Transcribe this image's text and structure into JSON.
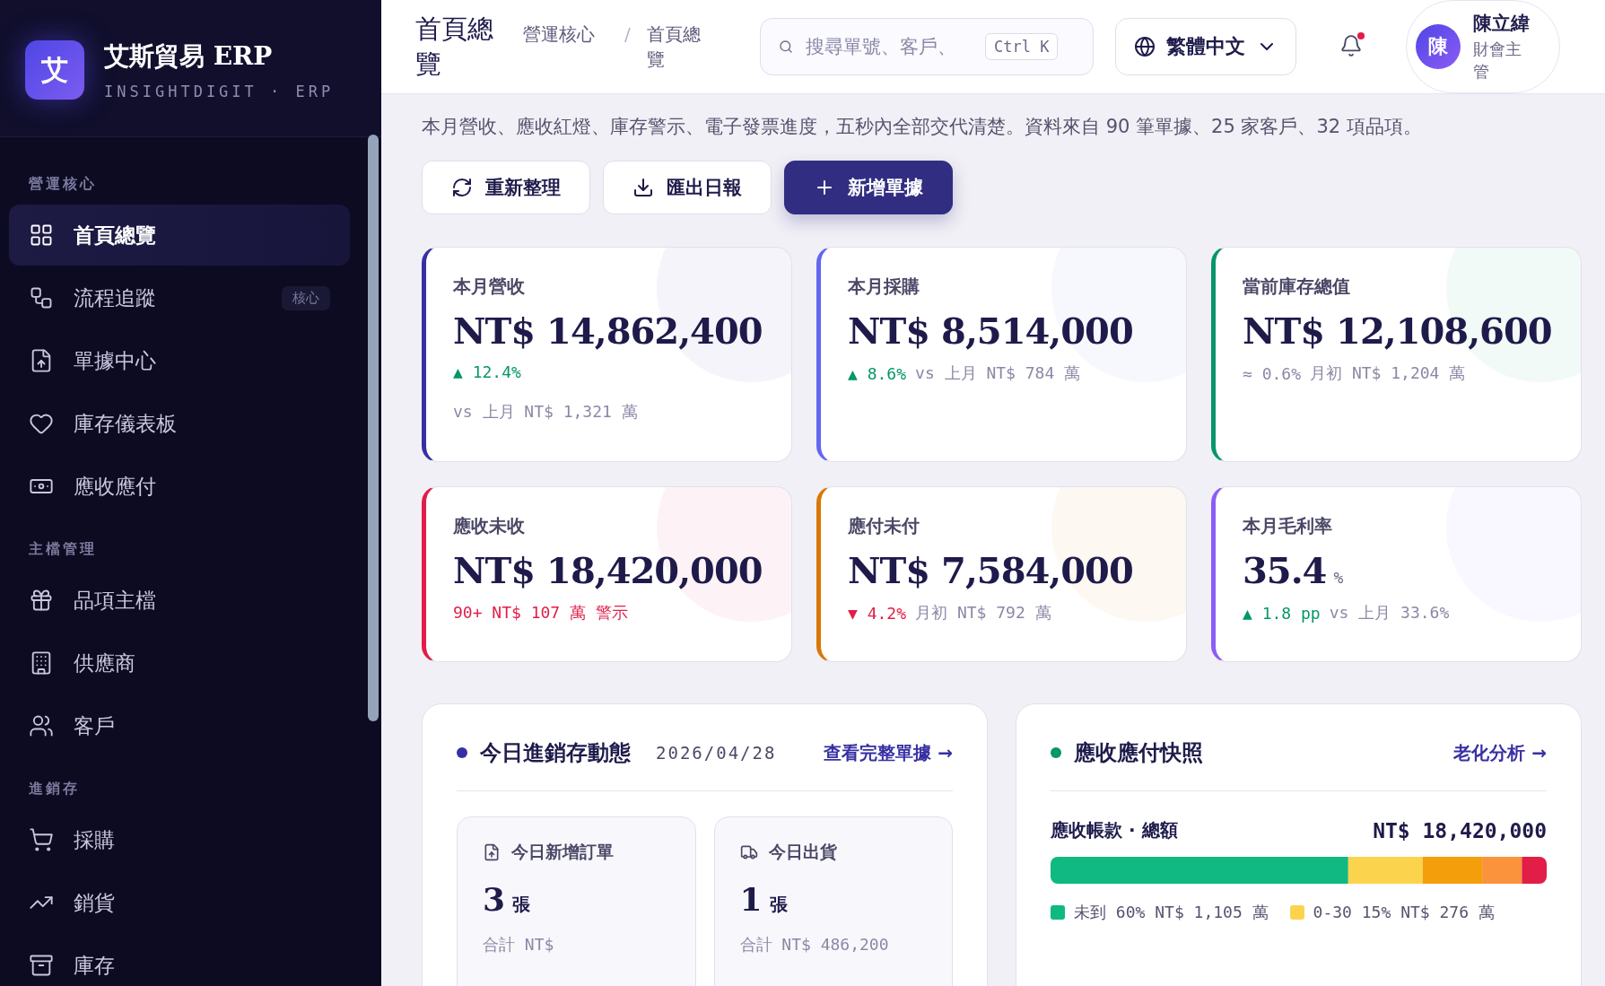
{
  "sidebar": {
    "brand": {
      "logo_letter": "艾",
      "name": "艾斯貿易 ERP",
      "subtitle": "INSIGHTDIGIT · ERP"
    },
    "sections": [
      {
        "title": "營運核心",
        "items": [
          {
            "label": "首頁總覽",
            "selected": true
          },
          {
            "label": "流程追蹤",
            "selected": false,
            "badge": "核心"
          },
          {
            "label": "單據中心",
            "selected": false
          },
          {
            "label": "庫存儀表板",
            "selected": false
          },
          {
            "label": "應收應付",
            "selected": false
          }
        ]
      },
      {
        "title": "主檔管理",
        "items": [
          {
            "label": "品項主檔",
            "selected": false
          },
          {
            "label": "供應商",
            "selected": false
          },
          {
            "label": "客戶",
            "selected": false
          }
        ]
      },
      {
        "title": "進銷存",
        "items": [
          {
            "label": "採購",
            "selected": false
          },
          {
            "label": "銷貨",
            "selected": false
          },
          {
            "label": "庫存",
            "selected": false
          }
        ]
      }
    ]
  },
  "header": {
    "title": "首頁總覽",
    "breadcrumb": [
      "營運核心",
      "首頁總覽"
    ],
    "breadcrumb_separator": "/",
    "search": {
      "placeholder": "搜尋單號、客戶、",
      "shortcut": "Ctrl K"
    },
    "language": "繁體中文",
    "notification_dot": true,
    "user": {
      "avatar_letter": "陳",
      "name": "陳立緯",
      "role": "財會主管"
    }
  },
  "intro": "本月營收、應收紅燈、庫存警示、電子發票進度，五秒內全部交代清楚。資料來自 90 筆單據、25 家客戶、32 項品項。",
  "actions": [
    {
      "label": "重新整理",
      "kind": "refresh"
    },
    {
      "label": "匯出日報",
      "kind": "export"
    },
    {
      "label": "新增單據",
      "kind": "primary"
    }
  ],
  "kpis": [
    {
      "label": "本月營收",
      "value": "NT$ 14,862,400",
      "color": "#3730a3",
      "trend": {
        "marker": "▲",
        "text": "12.4%",
        "color": "#059669"
      },
      "note": "vs 上月 NT$ 1,321 萬",
      "note_below": true,
      "alert": false
    },
    {
      "label": "本月採購",
      "value": "NT$ 8,514,000",
      "color": "#6366f1",
      "trend": {
        "marker": "▲",
        "text": "8.6%",
        "color": "#059669"
      },
      "note": "vs 上月 NT$ 784 萬",
      "note_below": false,
      "alert": false
    },
    {
      "label": "當前庫存總值",
      "value": "NT$ 12,108,600",
      "color": "#059669",
      "trend": {
        "marker": "≈",
        "text": "0.6%",
        "color": "#8a88a6"
      },
      "note": "月初 NT$ 1,204 萬",
      "note_below": false,
      "alert": false
    },
    {
      "label": "應收未收",
      "value": "NT$ 18,420,000",
      "color": "#e11d48",
      "note": "90+ NT$ 107 萬 警示",
      "note_below": false,
      "alert": true
    },
    {
      "label": "應付未付",
      "value": "NT$ 7,584,000",
      "color": "#d97706",
      "trend": {
        "marker": "▼",
        "text": "4.2%",
        "color": "#e11d48"
      },
      "note": "月初 NT$ 792 萬",
      "note_below": false,
      "alert": false
    },
    {
      "label": "本月毛利率",
      "value": "35.4",
      "unit": "%",
      "color": "#8b5cf6",
      "trend": {
        "marker": "▲",
        "text": "1.8 pp",
        "color": "#059669"
      },
      "note": "vs 上月 33.6%",
      "note_below": false,
      "alert": false
    }
  ],
  "activity": {
    "title": "今日進銷存動態",
    "color": "#3730a3",
    "date": "2026/04/28",
    "link": "查看完整單據 →",
    "stats": [
      {
        "label": "今日新增訂單",
        "value": "3",
        "unit": "張",
        "total": "合計 NT$"
      },
      {
        "label": "今日出貨",
        "value": "1",
        "unit": "張",
        "total": "合計 NT$ 486,200"
      }
    ]
  },
  "snapshot": {
    "title": "應收應付快照",
    "color": "#059669",
    "link": "老化分析 →",
    "receivable_label": "應收帳款 · 總額",
    "receivable_total": "NT$ 18,420,000",
    "legend": [
      {
        "label": "未到",
        "share": "60%",
        "amount": "NT$ 1,105 萬",
        "color": "#10b981"
      },
      {
        "label": "0-30",
        "share": "15%",
        "amount": "NT$ 276 萬",
        "color": "#fcd34d"
      }
    ]
  }
}
